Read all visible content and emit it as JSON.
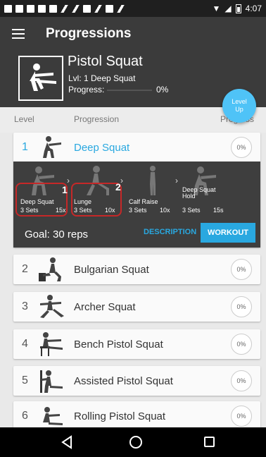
{
  "status_bar": {
    "time": "4:07"
  },
  "app_bar": {
    "title": "Progressions",
    "menu_icon": "hamburger-menu-icon"
  },
  "header": {
    "exercise_name": "Pistol Squat",
    "level_line": "Lvl: 1 Deep Squat",
    "progress_label": "Progress:",
    "progress_value": 0,
    "progress_text": "0%"
  },
  "level_up_button": {
    "line1": "Level",
    "line2": "Up"
  },
  "columns": {
    "level": "Level",
    "progression": "Progression",
    "progress": "Progress"
  },
  "progressions": [
    {
      "number": "1",
      "name": "Deep Squat",
      "progress": "0%"
    },
    {
      "number": "2",
      "name": "Bulgarian Squat",
      "progress": "0%"
    },
    {
      "number": "3",
      "name": "Archer Squat",
      "progress": "0%"
    },
    {
      "number": "4",
      "name": "Bench Pistol Squat",
      "progress": "0%"
    },
    {
      "number": "5",
      "name": "Assisted Pistol Squat",
      "progress": "0%"
    },
    {
      "number": "6",
      "name": "Rolling Pistol Squat",
      "progress": "0%"
    }
  ],
  "detail": {
    "steps": [
      {
        "name": "Deep Squat",
        "sets": "3 Sets",
        "reps": "15x"
      },
      {
        "name": "Lunge",
        "sets": "3 Sets",
        "reps": "10x"
      },
      {
        "name": "Calf Raise",
        "sets": "3 Sets",
        "reps": "10x"
      },
      {
        "name": "Deep Squat\nHold",
        "sets": "3 Sets",
        "reps": "15s"
      }
    ],
    "markers": [
      "1",
      "2"
    ],
    "goal": "Goal: 30 reps",
    "description_label": "DESCRIPTION",
    "workout_label": "WORKOUT"
  },
  "colors": {
    "accent": "#29a8e0",
    "header_bg": "#3b3b3b",
    "marker": "#c62828"
  }
}
